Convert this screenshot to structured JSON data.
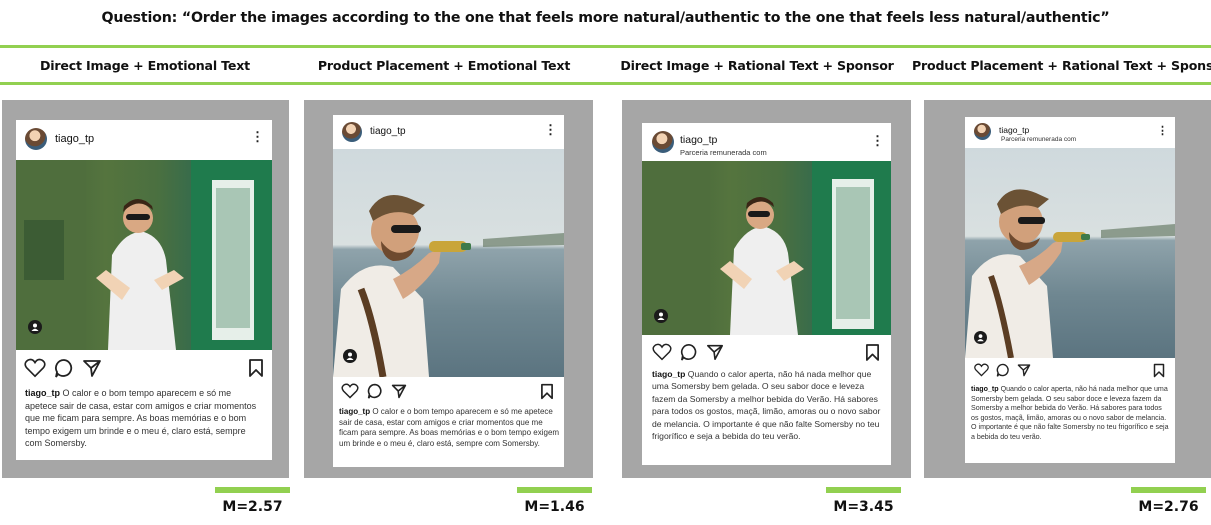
{
  "question": "Question: “Order the images according to the one that feels more natural/authentic to the one that feels less natural/authentic”",
  "columns": [
    {
      "label": "Direct Image + Emotional Text",
      "post": {
        "username": "tiago_tp",
        "sponsor_line": "",
        "caption_user": "tiago_tp",
        "caption_text": " O calor e o bom tempo aparecem e só me apetece sair de casa, estar com amigos e criar momentos que me ficam para sempre. As boas memórias e o bom tempo exigem um brinde e o meu é, claro está, sempre com Somersby."
      },
      "mean": "M=2.57"
    },
    {
      "label": "Product Placement + Emotional Text",
      "post": {
        "username": "tiago_tp",
        "sponsor_line": "",
        "caption_user": "tiago_tp",
        "caption_text": " O calor e o bom tempo aparecem e só me apetece sair de casa, estar com amigos e criar momentos que me ficam para sempre. As boas memórias e o bom tempo exigem um brinde e o meu é, claro está, sempre com Somersby."
      },
      "mean": "M=1.46"
    },
    {
      "label": "Direct Image + Rational Text + Sponsor",
      "post": {
        "username": "tiago_tp",
        "sponsor_line": "Parceria remunerada com",
        "caption_user": "tiago_tp",
        "caption_text": " Quando o calor aperta, não há nada melhor que uma Somersby bem gelada. O seu sabor doce e leveza fazem da Somersby a melhor bebida do Verão. Há sabores para todos os gostos, maçã, limão, amoras ou o novo sabor de melancia. O importante é que não falte Somersby no teu frigorífico e seja a bebida do teu verão."
      },
      "mean": "M=3.45"
    },
    {
      "label": "Product Placement + Rational Text + Sponsor",
      "post": {
        "username": "tiago_tp",
        "sponsor_line": "Parceria remunerada com",
        "caption_user": "tiago_tp",
        "caption_text": " Quando o calor aperta, não há nada melhor que uma Somersby bem gelada. O seu sabor doce e leveza fazem da Somersby a melhor bebida do Verão. Há sabores para todos os gostos, maçã, limão, amoras ou o novo sabor de melancia. O importante é que não falte Somersby no teu frigorífico e seja a bebida do teu verão."
      },
      "mean": "M=2.76"
    }
  ],
  "icons": [
    "heart-icon",
    "comment-icon",
    "share-icon",
    "bookmark-icon",
    "more-options-icon",
    "user-tag-icon"
  ],
  "colors": {
    "accent_green": "#92d050",
    "panel_gray": "#a6a6a6"
  }
}
